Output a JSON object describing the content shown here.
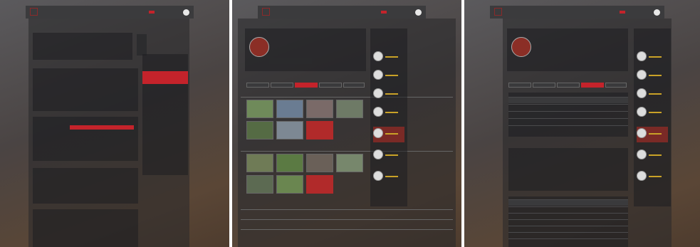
{
  "nav": {
    "items": [
      "",
      "",
      "",
      ""
    ],
    "active_index": 1
  },
  "screen1": {
    "title": "",
    "link": ""
  },
  "screen2": {
    "horse_name": "",
    "tabs": [
      "",
      "",
      "",
      "",
      ""
    ],
    "active_tab": 2,
    "sections": [
      "",
      "",
      "",
      "",
      ""
    ],
    "sidebar_title": ""
  },
  "screen3": {
    "horse_name": "",
    "tabs": [
      "",
      "",
      "",
      "",
      ""
    ],
    "active_tab": 3,
    "sidebar_title": ""
  },
  "colors": {
    "accent": "#c4232b",
    "topbar": "#3b3b3d",
    "gold": "#c9a227"
  },
  "icons": {
    "user": "user-icon",
    "logo": "logo-icon"
  }
}
